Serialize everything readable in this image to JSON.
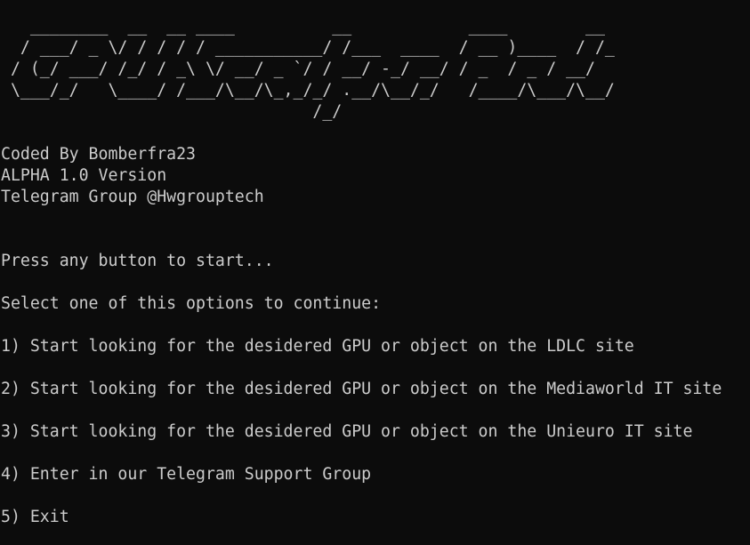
{
  "colors": {
    "background": "#0c0c0c",
    "foreground": "#cccccc"
  },
  "banner": {
    "ascii_art": "   ________  __  __ ____          __            ____        __\n  / ___/ _ \\/ / / / / ___________/ /___  ____  / __ )____  / /_\n / (_/ ___/ /_/ / _\\ \\/ __/ _ `/ / __/ -_/ __/ / _  / _ / __/\n \\___/_/   \\____/ /___/\\__/\\_,_/_/ .__/\\__/_/   /____/\\___/\\__/\n                                /_/"
  },
  "info": {
    "coded_by": "Coded By Bomberfra23",
    "version": "ALPHA 1.0 Version",
    "telegram": "Telegram Group @Hwgrouptech"
  },
  "prompts": {
    "press_any": "Press any button to start...",
    "select": "Select one of this options to continue:"
  },
  "menu": {
    "items": [
      {
        "label": "1) Start looking for the desidered GPU or object on the LDLC site"
      },
      {
        "label": "2) Start looking for the desidered GPU or object on the Mediaworld IT site"
      },
      {
        "label": "3) Start looking for the desidered GPU or object on the Unieuro IT site"
      },
      {
        "label": "4) Enter in our Telegram Support Group"
      },
      {
        "label": "5) Exit"
      }
    ]
  }
}
